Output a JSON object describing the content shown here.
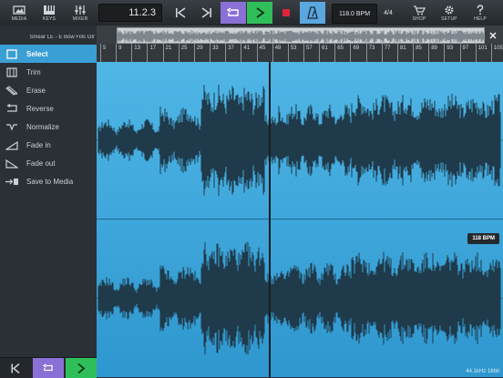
{
  "toolbar": {
    "media_label": "MEDIA",
    "keys_label": "KEYS",
    "mixer_label": "MIXER",
    "position": "11.2.3",
    "bpm": "118.0 BPM",
    "time_signature": "4/4",
    "shop_label": "SHOP",
    "setup_label": "SETUP",
    "help_label": "HELP",
    "colors": {
      "loop_active": "#8a6fd6",
      "play": "#2fbf5a",
      "record": "#e0243a",
      "metronome_active": "#5aa7e0"
    }
  },
  "sidebar": {
    "track_name": "Smear LE - E Bow Fills Gtr",
    "tools": [
      {
        "label": "Select",
        "icon": "select-icon",
        "active": true
      },
      {
        "label": "Trim",
        "icon": "trim-icon",
        "active": false
      },
      {
        "label": "Erase",
        "icon": "erase-icon",
        "active": false
      },
      {
        "label": "Reverse",
        "icon": "reverse-icon",
        "active": false
      },
      {
        "label": "Normalize",
        "icon": "normalize-icon",
        "active": false
      },
      {
        "label": "Fade in",
        "icon": "fade-in-icon",
        "active": false
      },
      {
        "label": "Fade out",
        "icon": "fade-out-icon",
        "active": false
      },
      {
        "label": "Save to Media",
        "icon": "save-to-media-icon",
        "active": false
      }
    ]
  },
  "ruler": {
    "marks": [
      "5",
      "9",
      "13",
      "17",
      "21",
      "25",
      "29",
      "33",
      "37",
      "41",
      "45",
      "49",
      "53",
      "57",
      "61",
      "65",
      "69",
      "73",
      "77",
      "81",
      "85",
      "89",
      "93",
      "97",
      "101",
      "105"
    ]
  },
  "editor": {
    "bpm_badge": "118 BPM",
    "format_info": "44.1kHz  16bit",
    "accent": "#3a9fd4"
  }
}
